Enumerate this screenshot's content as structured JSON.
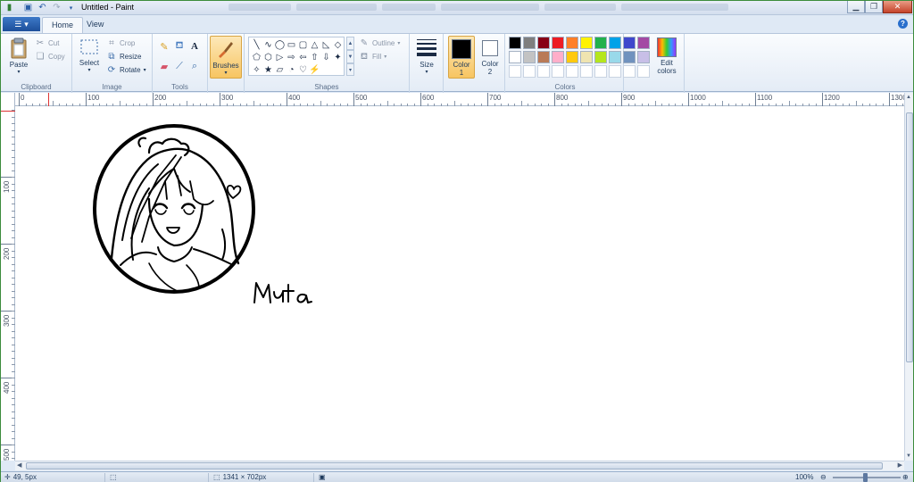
{
  "window": {
    "title": "Untitled - Paint"
  },
  "tabs": [
    {
      "label": "Home"
    },
    {
      "label": "View"
    }
  ],
  "ribbon": {
    "clipboard": {
      "label": "Clipboard",
      "paste": "Paste",
      "cut": "Cut",
      "copy": "Copy"
    },
    "image": {
      "label": "Image",
      "select": "Select",
      "crop": "Crop",
      "resize": "Resize",
      "rotate": "Rotate"
    },
    "tools": {
      "label": "Tools"
    },
    "brushes": {
      "label": "Brushes"
    },
    "shapes": {
      "label": "Shapes",
      "outline": "Outline",
      "fill": "Fill"
    },
    "size": {
      "label": "Size"
    },
    "color1": {
      "label": "Color",
      "index": "1",
      "value": "#000000"
    },
    "color2": {
      "label": "Color",
      "index": "2",
      "value": "#ffffff"
    },
    "colors": {
      "label": "Colors",
      "palette_row1": [
        "#000000",
        "#7f7f7f",
        "#880015",
        "#ed1c24",
        "#ff7f27",
        "#fff200",
        "#22b14c",
        "#00a2e8",
        "#3f48cc",
        "#a349a4"
      ],
      "palette_row2": [
        "#ffffff",
        "#c3c3c3",
        "#b97a57",
        "#ffaec9",
        "#ffc90e",
        "#efe4b0",
        "#b5e61d",
        "#99d9ea",
        "#7092be",
        "#c8bfe7"
      ]
    },
    "edit_colors": "Edit colors"
  },
  "ruler": {
    "h_labels": [
      "0",
      "100",
      "200",
      "300",
      "400",
      "500",
      "600",
      "700",
      "800",
      "900",
      "1000",
      "1100",
      "1200",
      "1300"
    ],
    "v_labels": [
      "100",
      "200",
      "300",
      "400",
      "500"
    ]
  },
  "canvas": {
    "signature": "Muta"
  },
  "status": {
    "cursor": "49, 5px",
    "image_size": "1341 × 702px",
    "zoom": "100%"
  }
}
